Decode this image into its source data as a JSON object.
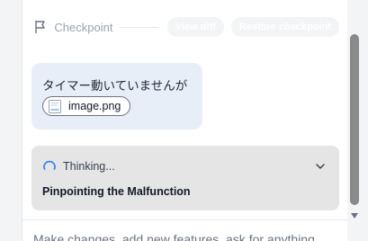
{
  "checkpoint": {
    "label": "Checkpoint",
    "view_diff_label": "View diff",
    "restore_label": "Restore checkpoint"
  },
  "user_message": {
    "text": "タイマー動いていませんが",
    "attachment_name": "image.png"
  },
  "thinking": {
    "status_label": "Thinking...",
    "title": "Pinpointing the Malfunction"
  },
  "composer": {
    "placeholder": "Make changes, add new features, ask for anything"
  },
  "icons": {
    "checkpoint": "flag-icon",
    "attachment": "image-file-icon",
    "thinking": "spinner-icon",
    "expand": "chevron-down-icon"
  },
  "colors": {
    "user_bubble": "#e8eef8",
    "thinking_card": "#e5e5e5",
    "spinner": "#3b82f6"
  }
}
